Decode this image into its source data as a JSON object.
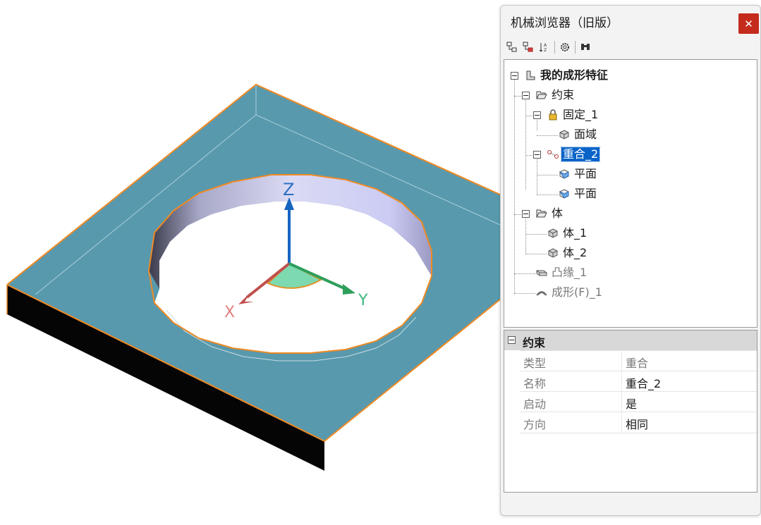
{
  "viewport": {
    "axes": {
      "x_label": "X",
      "y_label": "Y",
      "z_label": "Z"
    }
  },
  "panel": {
    "title": "机械浏览器（旧版）",
    "close_icon": "close-icon",
    "toolbar": [
      "expand-all-icon",
      "collapse-all-icon",
      "sort-az-icon",
      "settings-gear-icon",
      "find-binoculars-icon"
    ]
  },
  "tree": {
    "root": "我的成形特征",
    "constraints": "约束",
    "fix": "固定_1",
    "fix_child": "面域",
    "coincident": "重合_2",
    "plane1": "平面",
    "plane2": "平面",
    "bodies": "体",
    "body1": "体_1",
    "body2": "体_2",
    "flange": "凸缘_1",
    "form": "成形(F)_1"
  },
  "properties": {
    "group": "约束",
    "rows": [
      {
        "key": "类型",
        "value": "重合"
      },
      {
        "key": "名称",
        "value": "重合_2"
      },
      {
        "key": "启动",
        "value": "是"
      },
      {
        "key": "方向",
        "value": "相同"
      }
    ]
  },
  "colors": {
    "face": "#5899ad",
    "edge": "#f08a24",
    "side": "#050505",
    "selection": "#0a64c8"
  }
}
